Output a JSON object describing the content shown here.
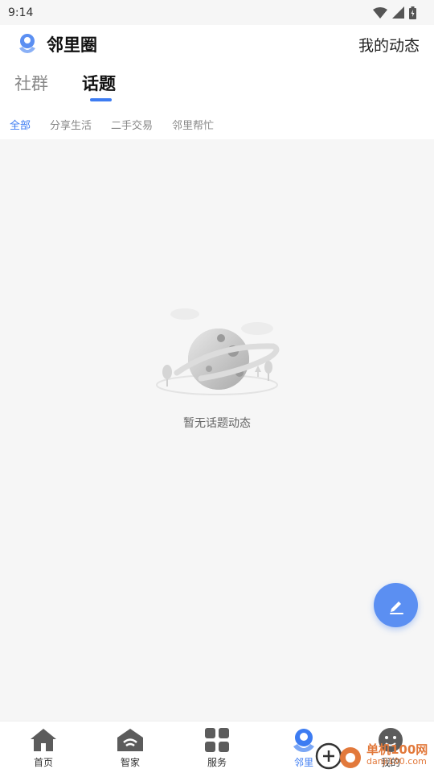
{
  "status_bar": {
    "time": "9:14"
  },
  "header": {
    "app_title": "邻里圈",
    "my_activity": "我的动态",
    "main_tabs": [
      {
        "label": "社群",
        "active": false
      },
      {
        "label": "话题",
        "active": true
      }
    ],
    "sub_tabs": [
      {
        "label": "全部",
        "active": true
      },
      {
        "label": "分享生活",
        "active": false
      },
      {
        "label": "二手交易",
        "active": false
      },
      {
        "label": "邻里帮忙",
        "active": false
      }
    ]
  },
  "empty_state": {
    "message": "暂无话题动态"
  },
  "fab": {
    "icon": "edit-icon"
  },
  "bottom_nav": [
    {
      "label": "首页",
      "icon": "home-icon",
      "active": false
    },
    {
      "label": "智家",
      "icon": "smart-home-icon",
      "active": false
    },
    {
      "label": "服务",
      "icon": "grid-icon",
      "active": false
    },
    {
      "label": "邻里",
      "icon": "neighbor-icon",
      "active": true
    },
    {
      "label": "我的",
      "icon": "profile-icon",
      "active": false
    }
  ],
  "watermark": {
    "text": "单机100网",
    "sub": "danji100.com"
  },
  "colors": {
    "accent": "#3d7cf2",
    "fab": "#5b8ff2",
    "background": "#f6f6f6"
  }
}
